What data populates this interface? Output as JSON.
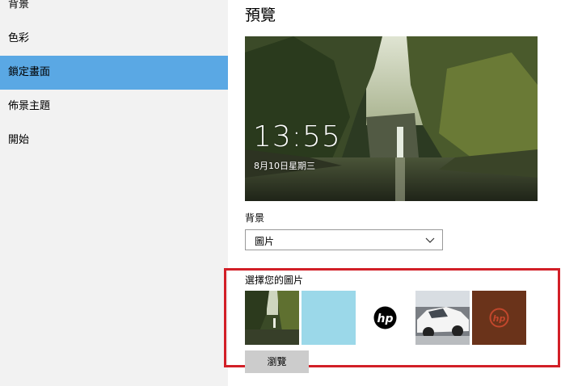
{
  "sidebar": {
    "items": [
      {
        "label": "背景",
        "selected": false
      },
      {
        "label": "色彩",
        "selected": false
      },
      {
        "label": "鎖定畫面",
        "selected": true
      },
      {
        "label": "佈景主題",
        "selected": false
      },
      {
        "label": "開始",
        "selected": false
      }
    ]
  },
  "main": {
    "title": "預覽",
    "preview": {
      "time": "13:55",
      "date": "8月10日星期三"
    },
    "background": {
      "label": "背景",
      "selected_value": "圖片"
    },
    "choose_pictures": {
      "label": "選擇您的圖片",
      "thumbnails": [
        "waterfall-forest",
        "light-blue",
        "hp-logo-white",
        "white-suv",
        "hp-logo-wood"
      ],
      "browse_label": "瀏覽"
    }
  },
  "colors": {
    "accent": "#5aa8e4",
    "highlight_border": "#d21f27",
    "sidebar_bg": "#f2f2f2"
  }
}
